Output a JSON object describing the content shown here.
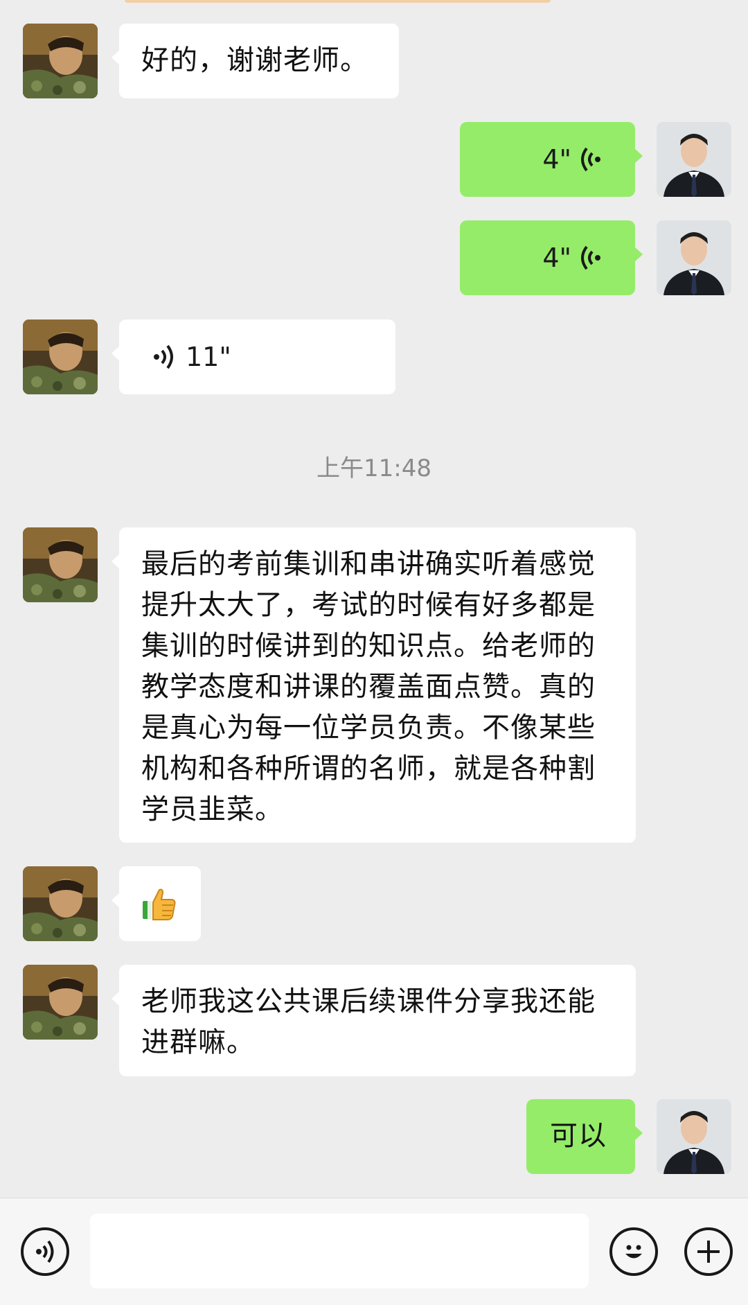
{
  "chat": {
    "messages": [
      {
        "sender": "student",
        "type": "text",
        "text": "好的，谢谢老师。"
      },
      {
        "sender": "teacher",
        "type": "voice",
        "duration": "4\""
      },
      {
        "sender": "teacher",
        "type": "voice",
        "duration": "4\""
      },
      {
        "sender": "student",
        "type": "voice",
        "duration": "11\""
      },
      {
        "type": "timestamp",
        "text": "上午11:48"
      },
      {
        "sender": "student",
        "type": "text",
        "text": "最后的考前集训和串讲确实听着感觉提升太大了，考试的时候有好多都是集训的时候讲到的知识点。给老师的教学态度和讲课的覆盖面点赞。真的是真心为每一位学员负责。不像某些机构和各种所谓的名师，就是各种割学员韭菜。"
      },
      {
        "sender": "student",
        "type": "emoji",
        "icon": "thumbs-up-icon"
      },
      {
        "sender": "student",
        "type": "text",
        "text": "老师我这公共课后续课件分享我还能进群嘛。"
      },
      {
        "sender": "teacher",
        "type": "text",
        "text": "可以"
      }
    ]
  },
  "input_bar": {
    "voice_icon": "voice-mode-icon",
    "emoji_icon": "emoji-icon",
    "more_icon": "plus-icon"
  },
  "colors": {
    "background": "#ededed",
    "incoming_bubble": "#ffffff",
    "outgoing_bubble": "#95ec69",
    "timestamp": "#8a8a8a"
  }
}
